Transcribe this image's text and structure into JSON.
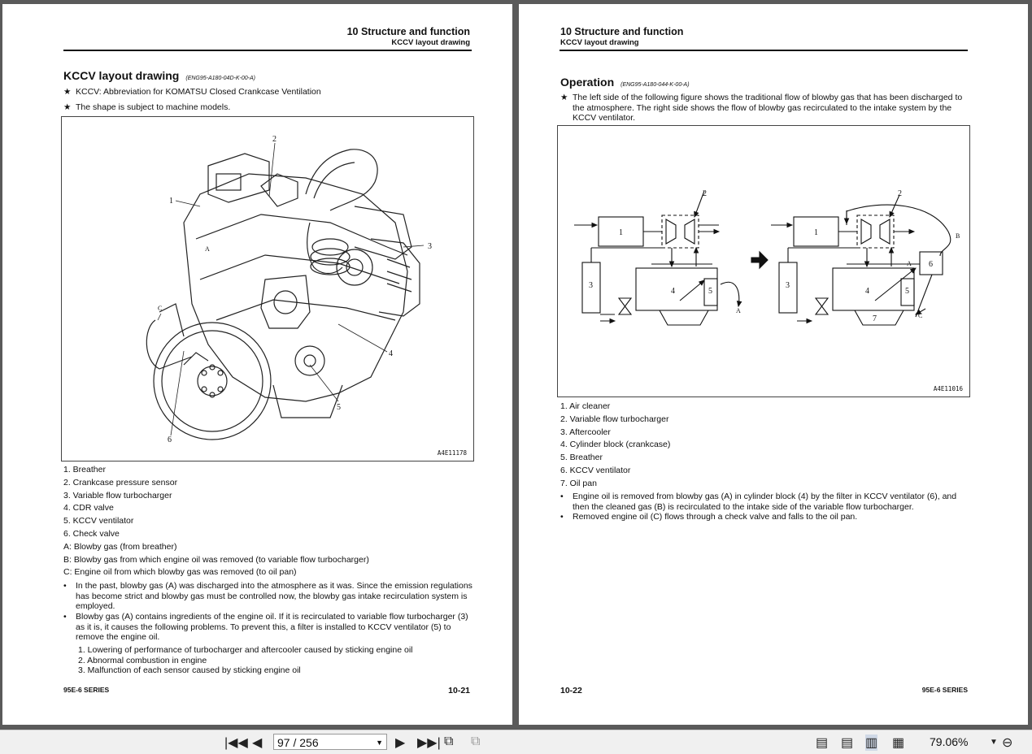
{
  "left_page": {
    "header_title": "10 Structure and function",
    "header_sub": "KCCV layout drawing",
    "section_title": "KCCV layout drawing",
    "section_code": "(ENG95-A180-04D-K-00-A)",
    "notes": [
      "KCCV: Abbreviation for KOMATSU Closed Crankcase Ventilation",
      "The shape is subject to machine models."
    ],
    "figure_code": "A4E11178",
    "callouts": [
      "1",
      "2",
      "3",
      "4",
      "5",
      "6",
      "A",
      "C"
    ],
    "items": [
      "1. Breather",
      "2. Crankcase pressure sensor",
      "3. Variable flow turbocharger",
      "4. CDR valve",
      "5. KCCV ventilator",
      "6. Check valve",
      "A: Blowby gas (from breather)",
      "B: Blowby gas from which engine oil was removed (to variable flow turbocharger)",
      "C: Engine oil from which blowby gas was removed (to oil pan)"
    ],
    "bullets": [
      [
        "In the past, blowby gas (A) was discharged into the atmosphere as it was. Since the emission regulations",
        "has become strict and blowby gas must be controlled now, the blowby gas intake recirculation system is",
        "employed."
      ],
      [
        "Blowby gas (A) contains ingredients of the engine oil. If it is recirculated to variable flow turbocharger (3)",
        "as it is, it causes the following problems. To prevent this, a filter is installed to KCCV ventilator (5) to",
        "remove the engine oil."
      ]
    ],
    "sub_items": [
      "1.  Lowering of performance of turbocharger and aftercooler caused by sticking engine oil",
      "2.  Abnormal combustion in engine",
      "3.  Malfunction of each sensor caused by sticking engine oil"
    ],
    "footer_series": "95E-6 SERIES",
    "page_number": "10-21"
  },
  "right_page": {
    "header_title": "10 Structure and function",
    "header_sub": "KCCV layout drawing",
    "section_title": "Operation",
    "section_code": "(ENG95-A180-044-K-00-A)",
    "note_lines": [
      "The left side of the following figure shows the traditional flow of blowby gas that has been discharged to",
      "the atmosphere. The right side shows the flow of blowby gas recirculated to the intake system by the",
      "KCCV ventilator."
    ],
    "figure_code": "A4E11016",
    "diagram_labels": [
      "1",
      "2",
      "3",
      "4",
      "5",
      "6",
      "7",
      "A",
      "B",
      "C"
    ],
    "items": [
      "1. Air cleaner",
      "2. Variable flow turbocharger",
      "3. Aftercooler",
      "4. Cylinder block (crankcase)",
      "5. Breather",
      "6. KCCV ventilator",
      "7. Oil pan"
    ],
    "bullets": [
      [
        "Engine oil is removed from blowby gas (A) in cylinder block (4) by the filter in KCCV ventilator (6), and",
        "then the cleaned gas (B) is recirculated to the intake side of the variable flow turbocharger."
      ],
      [
        "Removed engine oil (C) flows through a check valve and falls to the oil pan."
      ]
    ],
    "page_number": "10-22",
    "footer_series": "95E-6 SERIES"
  },
  "toolbar": {
    "page_indicator": "97 / 256",
    "zoom": "79.06%"
  }
}
